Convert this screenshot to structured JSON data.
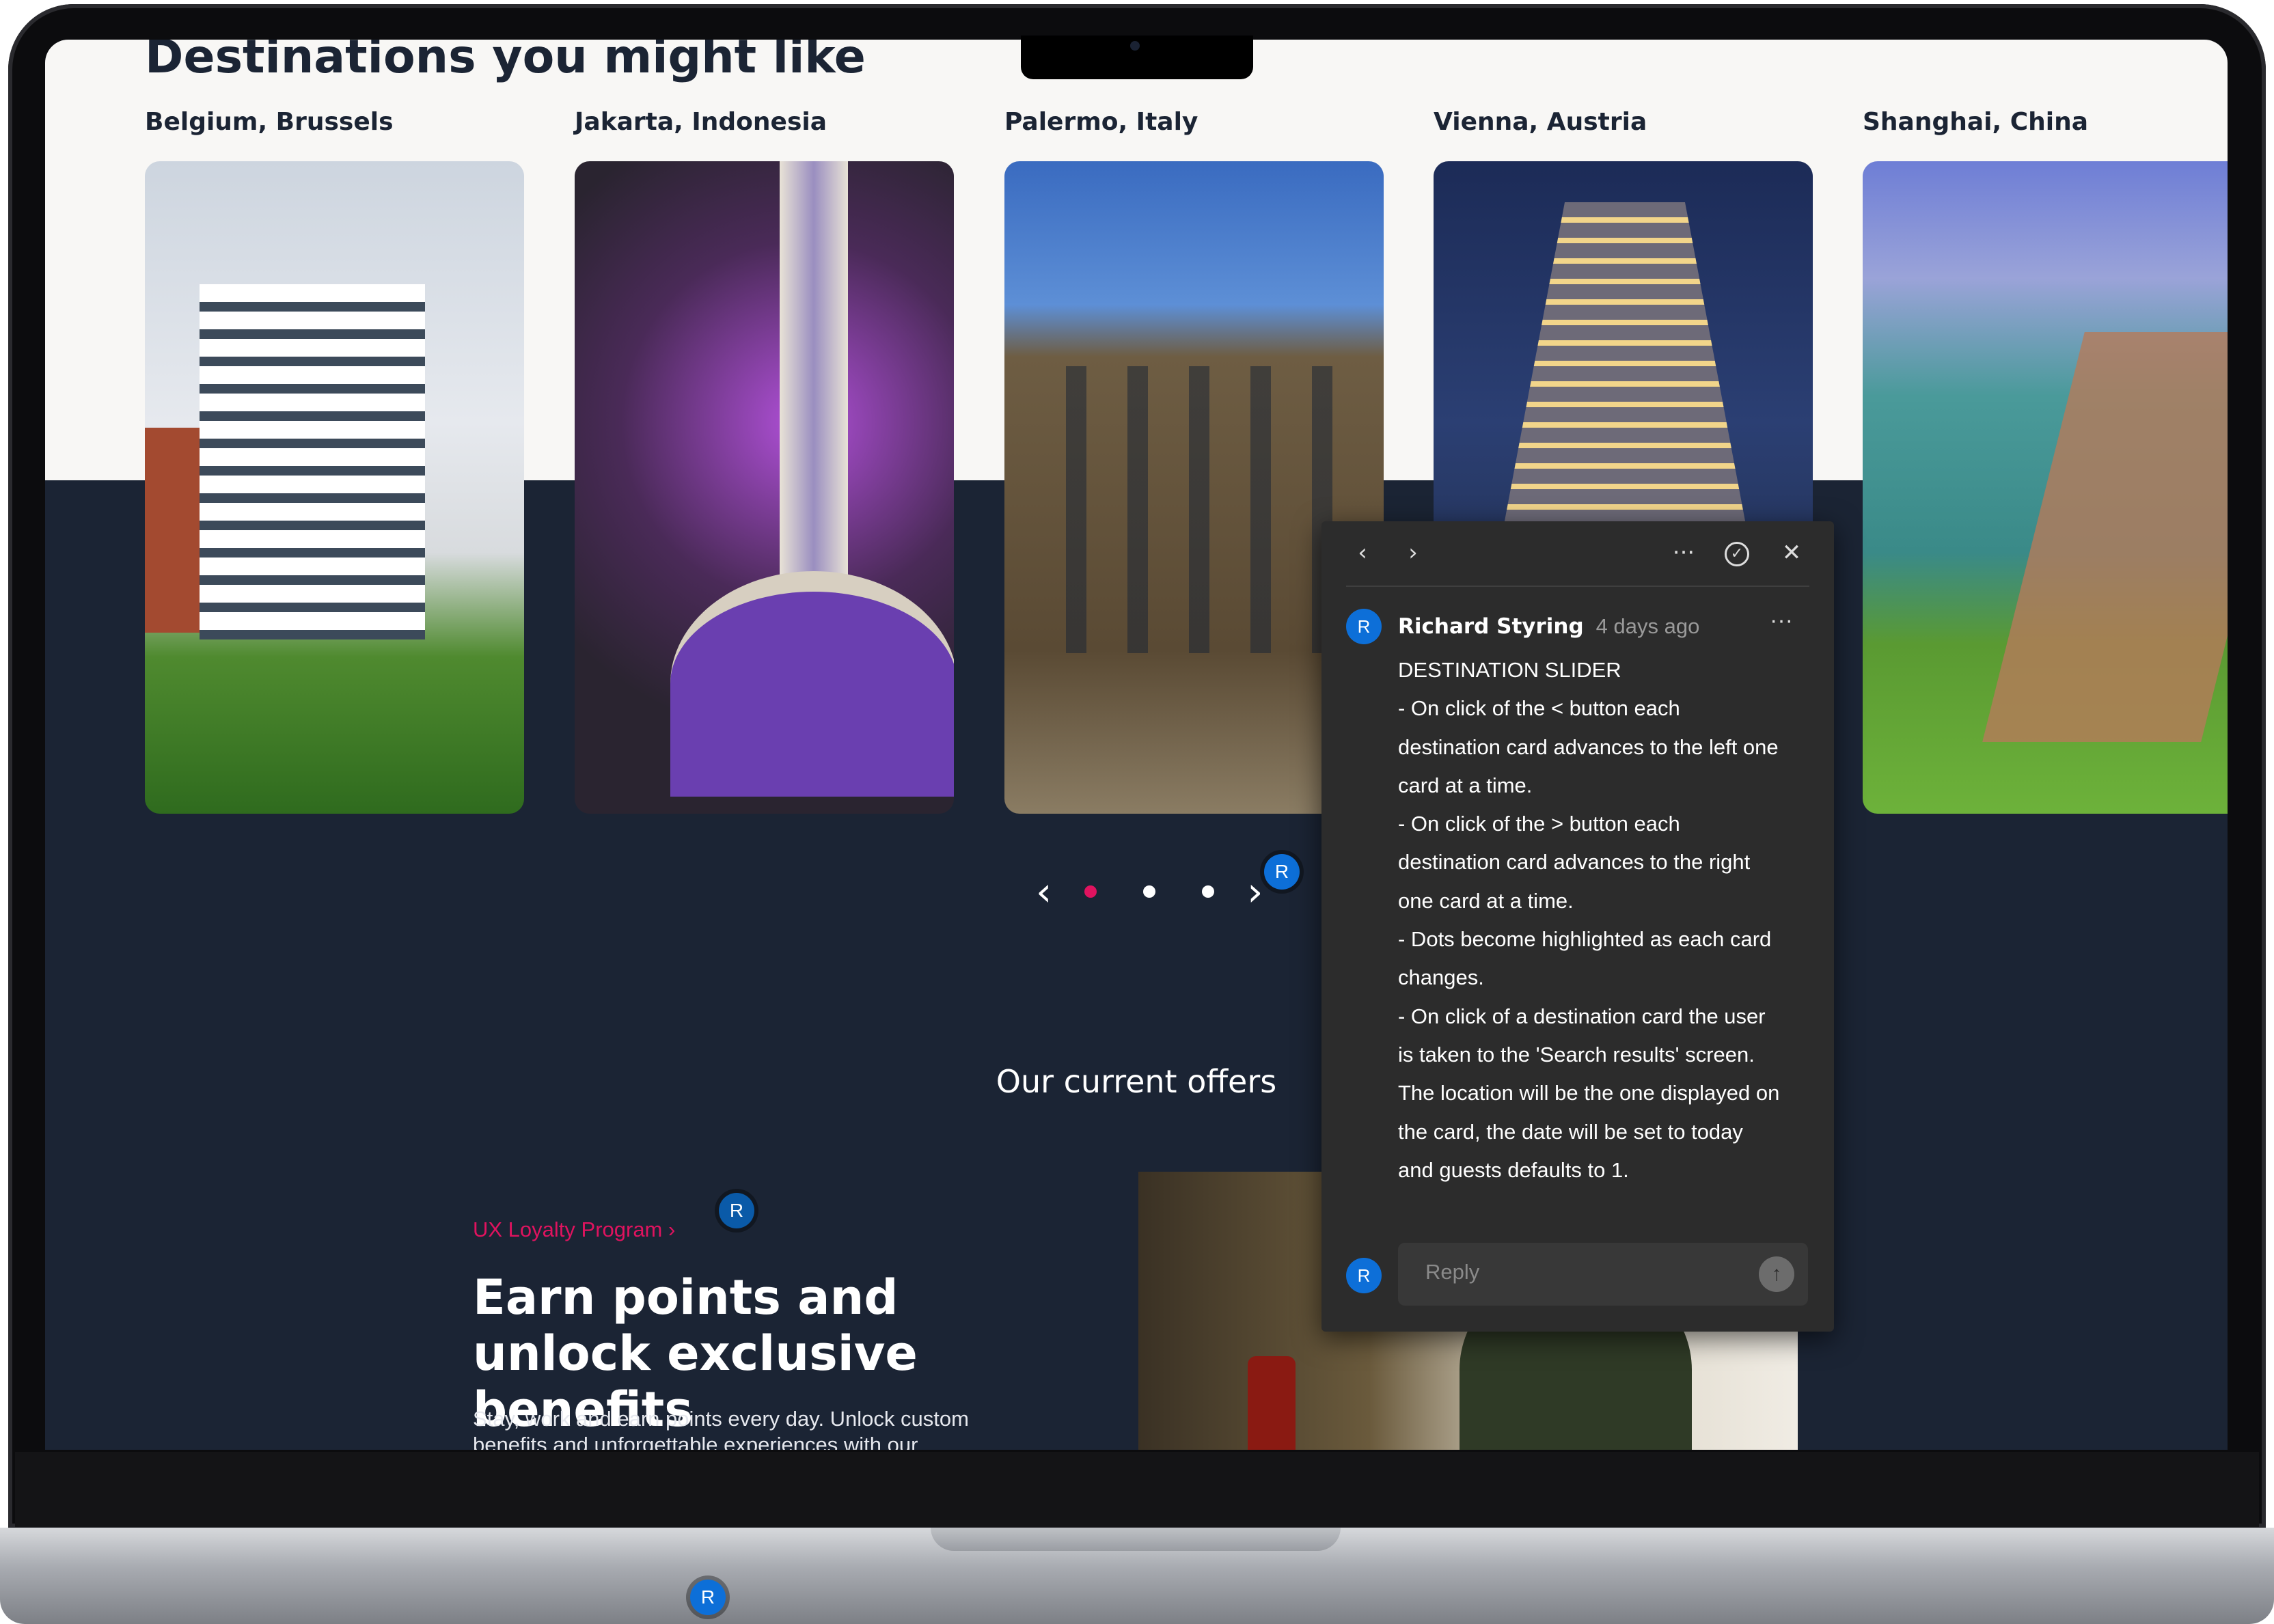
{
  "page": {
    "section_title": "Destinations you might like",
    "destinations": [
      {
        "label": "Belgium, Brussels"
      },
      {
        "label": "Jakarta, Indonesia"
      },
      {
        "label": "Palermo, Italy"
      },
      {
        "label": "Vienna, Austria"
      },
      {
        "label": "Shanghai, China"
      }
    ],
    "slider": {
      "prev_icon": "‹",
      "next_icon": "›",
      "active_dot": 1,
      "dot_count": 3
    },
    "offers_title": "Our current offers",
    "loyalty_link": "UX Loyalty Program",
    "earn_title": "Earn points and unlock exclusive benefits",
    "earn_desc": "Stay, work and earn points every day. Unlock custom benefits and unforgettable experiences with our"
  },
  "avatars": {
    "initial": "R",
    "color": "#0d6fd8"
  },
  "comment": {
    "author": "Richard Styring",
    "time": "4 days ago",
    "lines": [
      "DESTINATION SLIDER",
      "- On click of the < button each destination card advances to the left one card at a time.",
      "- On click of the > button each destination card advances to the right one card at a time.",
      "- Dots become highlighted as each card changes.",
      "- On click of a destination card the user is taken to the 'Search results' screen. The location will be the one displayed on the card, the date will be set to today and guests defaults to 1."
    ],
    "reply_placeholder": "Reply"
  },
  "colors": {
    "accent": "#e0135f",
    "dark_bg": "#1b2434",
    "panel": "#2c2c2c"
  }
}
